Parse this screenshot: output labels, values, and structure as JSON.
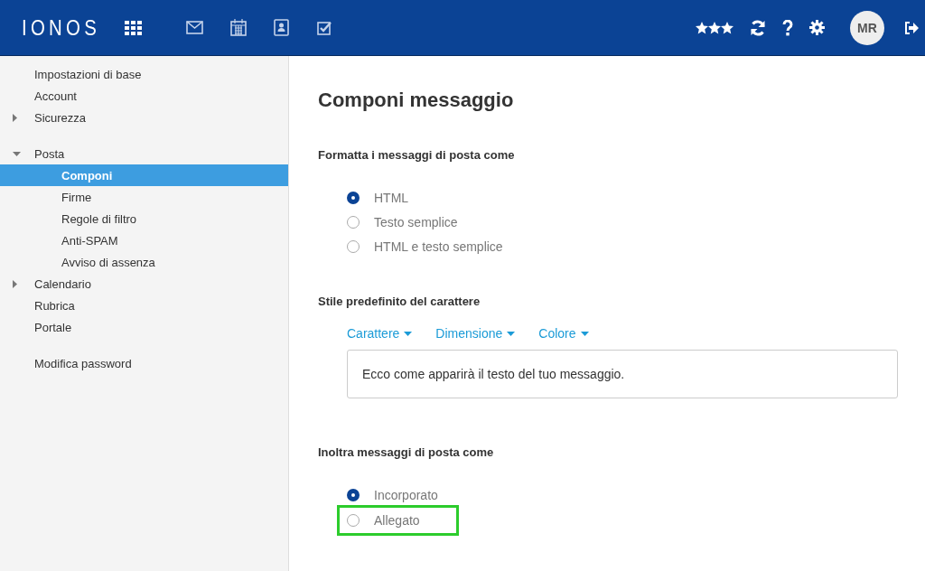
{
  "header": {
    "logo": "IONOS",
    "apps": [
      {
        "kind": "grid"
      },
      {
        "kind": "mail"
      },
      {
        "kind": "calendar"
      },
      {
        "kind": "contacts"
      },
      {
        "kind": "tasks"
      }
    ],
    "tools": [
      {
        "kind": "stars"
      },
      {
        "kind": "refresh"
      },
      {
        "kind": "help"
      },
      {
        "kind": "settings"
      }
    ],
    "avatar": "MR"
  },
  "sidebar": {
    "groups": [
      [
        {
          "label": "Impostazioni di base",
          "selected": false
        },
        {
          "label": "Account",
          "selected": false
        },
        {
          "label": "Sicurezza",
          "selected": false,
          "expanded": false
        }
      ],
      [
        {
          "label": "Posta",
          "selected": false,
          "expanded": true,
          "children": [
            {
              "label": "Componi",
              "selected": true
            },
            {
              "label": "Firme",
              "selected": false
            },
            {
              "label": "Regole di filtro",
              "selected": false
            },
            {
              "label": "Anti-SPAM",
              "selected": false
            },
            {
              "label": "Avviso di assenza",
              "selected": false
            }
          ]
        },
        {
          "label": "Calendario",
          "selected": false,
          "expanded": false
        },
        {
          "label": "Rubrica",
          "selected": false
        },
        {
          "label": "Portale",
          "selected": false
        }
      ],
      [
        {
          "label": "Modifica password",
          "selected": false
        }
      ]
    ]
  },
  "main": {
    "title": "Componi messaggio",
    "sections": [
      {
        "kind": "radios",
        "label": "Formatta i messaggi di posta come",
        "options": [
          {
            "label": "HTML",
            "selected": true,
            "highlighted": false
          },
          {
            "label": "Testo semplice",
            "selected": false,
            "highlighted": false
          },
          {
            "label": "HTML e testo semplice",
            "selected": false,
            "highlighted": false
          }
        ]
      },
      {
        "kind": "font",
        "label": "Stile predefinito del carattere",
        "menus": [
          "Carattere",
          "Dimensione",
          "Colore"
        ],
        "preview": "Ecco come apparirà il testo del tuo messaggio."
      },
      {
        "kind": "radios",
        "label": "Inoltra messaggi di posta come",
        "options": [
          {
            "label": "Incorporato",
            "selected": true,
            "highlighted": false
          },
          {
            "label": "Allegato",
            "selected": false,
            "highlighted": true
          }
        ]
      }
    ]
  }
}
